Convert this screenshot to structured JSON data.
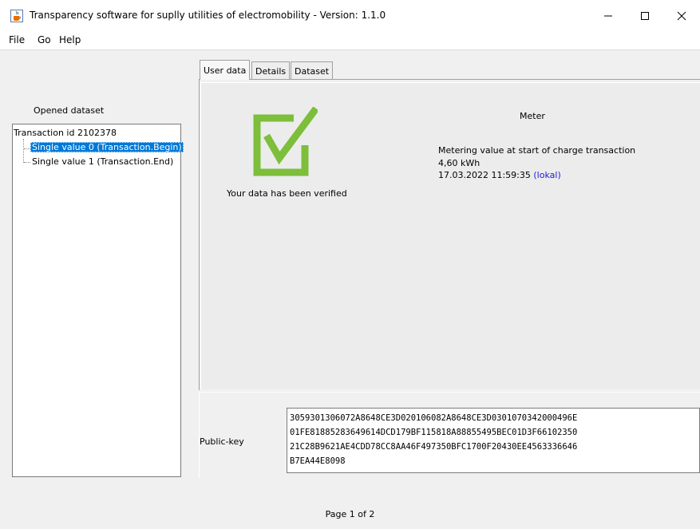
{
  "window": {
    "title": "Transparency software for suplly utilities of electromobility - Version: 1.1.0",
    "icon": "java-cup-icon",
    "controls": {
      "minimize": "—",
      "maximize": "☐",
      "close": "✕"
    }
  },
  "menu": {
    "items": [
      "File",
      "Go",
      "Help"
    ]
  },
  "left_panel": {
    "heading": "Opened dataset",
    "tree": {
      "root": "Transaction id 2102378",
      "children": [
        "Single value 0 (Transaction.Begin)",
        "Single value 1 (Transaction.End)"
      ],
      "selected_index": 0
    }
  },
  "tabs": [
    "User data",
    "Details",
    "Dataset"
  ],
  "active_tab": "User data",
  "verification": {
    "icon": "check-mark-icon",
    "message": "Your data has been verified",
    "color": "#7dbe3a"
  },
  "meter": {
    "title": "Meter",
    "description": "Metering value at start of charge transaction",
    "value": "4,60 kWh",
    "timestamp": "17.03.2022 11:59:35",
    "timezone_link": "(lokal)"
  },
  "public_key": {
    "label": "Public-key",
    "lines": [
      "3059301306072A8648CE3D020106082A8648CE3D0301070342000496E",
      "01FE81885283649614DCD179BF115818A88855495BEC01D3F66102350",
      "21C28B9621AE4CDD78CC8AA46F497350BFC1700F20430EE4563336646",
      "B7EA44E8098"
    ]
  },
  "footer": {
    "page": "Page 1 of 2"
  },
  "colors": {
    "selection": "#0078d7",
    "link": "#1a1ad6",
    "check": "#7dbe3a"
  }
}
